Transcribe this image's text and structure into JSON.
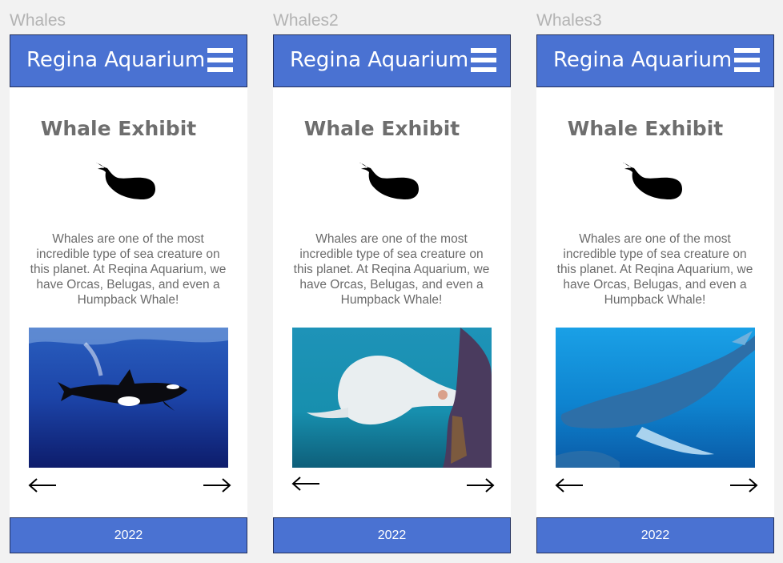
{
  "frames": [
    {
      "label": "Whales",
      "brand": "Regina Aquarium",
      "title": "Whale Exhibit",
      "description": "Whales are one of the most incredible type of sea creature on this planet. At Reqina Aquarium, we have Orcas, Belugas, and even a Humpback Whale!",
      "photo": "orca",
      "year": "2022"
    },
    {
      "label": "Whales2",
      "brand": "Regina Aquarium",
      "title": "Whale Exhibit",
      "description": "Whales are one of the most incredible type of sea creature on this planet. At Reqina Aquarium, we have Orcas, Belugas, and even a Humpback Whale!",
      "photo": "beluga",
      "year": "2022"
    },
    {
      "label": "Whales3",
      "brand": "Regina Aquarium",
      "title": "Whale Exhibit",
      "description": "Whales are one of the most incredible type of sea creature on this planet. At Reqina Aquarium, we have Orcas, Belugas, and even a Humpback Whale!",
      "photo": "humpback",
      "year": "2022"
    }
  ],
  "icons": {
    "menu": "hamburger-menu-icon",
    "logo": "whale-icon",
    "prev": "arrow-left-icon",
    "next": "arrow-right-icon"
  },
  "colors": {
    "header_bg": "#4a72d2",
    "header_border": "#23305c",
    "canvas_bg": "#f2f2f2",
    "title_text": "#6e6e6e",
    "body_text": "#6b6b6b"
  }
}
